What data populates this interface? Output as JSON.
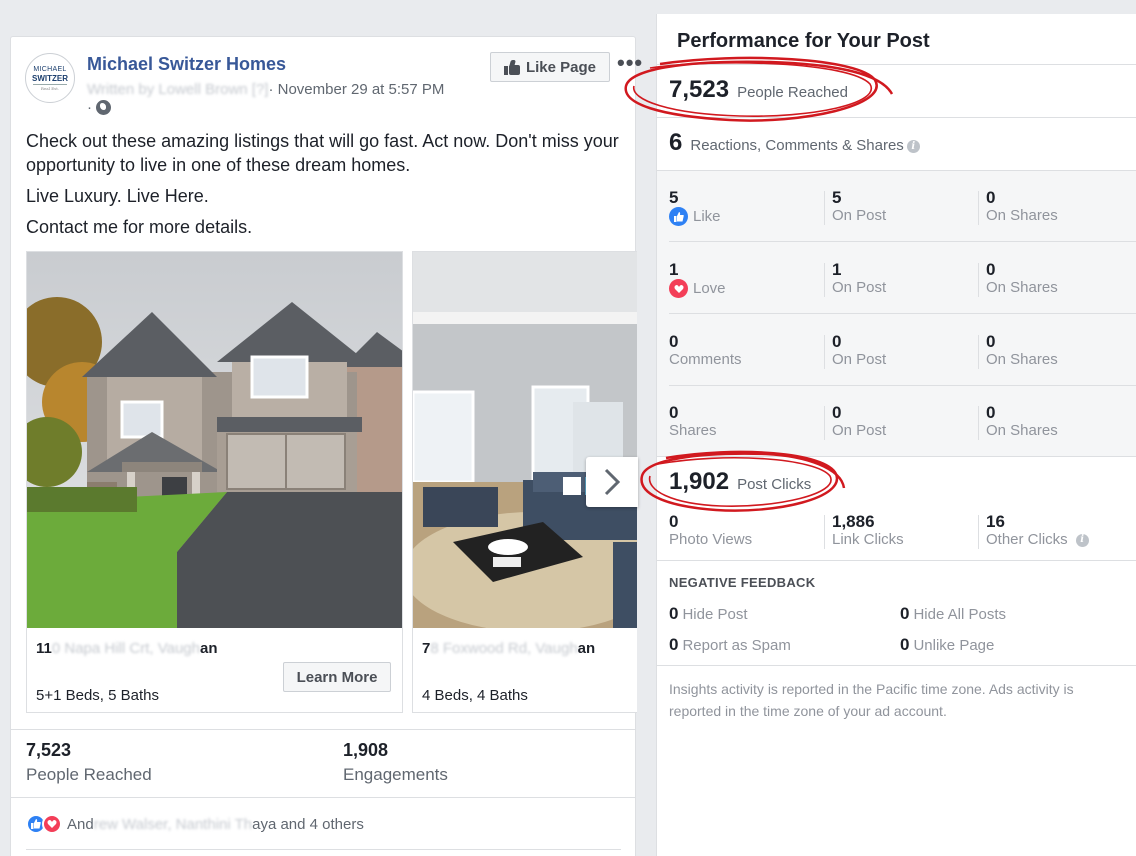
{
  "post": {
    "page_name": "Michael Switzer Homes",
    "avatar_text": {
      "line1": "MICHAEL",
      "line2": "SWITZER",
      "line3": "Real Est."
    },
    "written_by": "Written by Lowell Brown [?]",
    "timestamp": "· November 29 at 5:57 PM",
    "visibility_dot": "·",
    "like_page_label": "Like Page",
    "more_label": "•••",
    "text": [
      "Check out these amazing listings that will go fast. Act now. Don't miss your opportunity to live in one of these dream homes.",
      "Live Luxury. Live Here.",
      "Contact me for more details."
    ],
    "cards": [
      {
        "title_start": "11",
        "title_blur": "0 Napa Hill Crt, Vaugh",
        "title_end": "an",
        "desc": "5+1 Beds, 5 Baths",
        "cta": "Learn More"
      },
      {
        "title_start": "7",
        "title_blur": "8 Foxwood Rd, Vaugh",
        "title_end": "an",
        "desc": "4 Beds, 4 Baths"
      }
    ],
    "stats": [
      {
        "value": "7,523",
        "label": "People Reached"
      },
      {
        "value": "1,908",
        "label": "Engagements"
      }
    ],
    "reactions": {
      "start": "And",
      "blur": "rew Walser, Nanthini Th",
      "end": "aya and 4 others"
    }
  },
  "panel": {
    "title": "Performance for Your Post",
    "reached": {
      "value": "7,523",
      "label": "People Reached"
    },
    "engagement": {
      "value": "6",
      "label": "Reactions, Comments & Shares"
    },
    "grid": [
      {
        "total": "5",
        "label": "Like",
        "icon": "like-icon",
        "on_post": "5",
        "on_post_label": "On Post",
        "on_shares": "0",
        "on_shares_label": "On Shares"
      },
      {
        "total": "1",
        "label": "Love",
        "icon": "love-icon",
        "on_post": "1",
        "on_post_label": "On Post",
        "on_shares": "0",
        "on_shares_label": "On Shares"
      },
      {
        "total": "0",
        "label": "Comments",
        "on_post": "0",
        "on_post_label": "On Post",
        "on_shares": "0",
        "on_shares_label": "On Shares"
      },
      {
        "total": "0",
        "label": "Shares",
        "on_post": "0",
        "on_post_label": "On Post",
        "on_shares": "0",
        "on_shares_label": "On Shares"
      }
    ],
    "post_clicks": {
      "value": "1,902",
      "label": "Post Clicks"
    },
    "clicks": [
      {
        "value": "0",
        "label": "Photo Views"
      },
      {
        "value": "1,886",
        "label": "Link Clicks"
      },
      {
        "value": "16",
        "label": "Other Clicks"
      }
    ],
    "negative": {
      "title": "NEGATIVE FEEDBACK",
      "items": [
        {
          "value": "0",
          "label": "Hide Post"
        },
        {
          "value": "0",
          "label": "Hide All Posts"
        },
        {
          "value": "0",
          "label": "Report as Spam"
        },
        {
          "value": "0",
          "label": "Unlike Page"
        }
      ]
    },
    "footnote": "Insights activity is reported in the Pacific time zone. Ads activity is reported in the time zone of your ad account."
  },
  "colors": {
    "brand_blue": "#385898",
    "like_blue": "#2e81f4",
    "love_red": "#f33e58",
    "annotation_red": "#d1191f"
  }
}
